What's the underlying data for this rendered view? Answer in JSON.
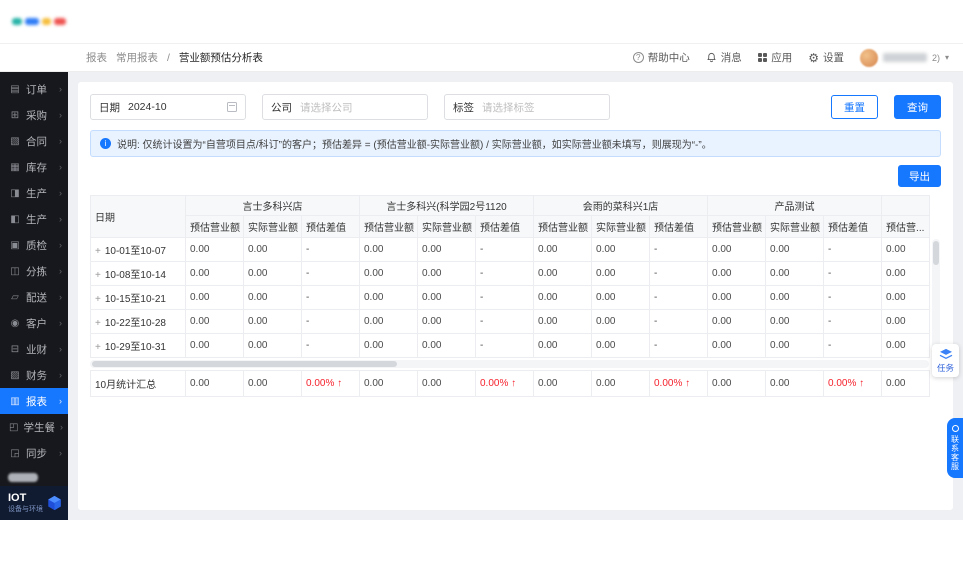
{
  "header": {
    "breadcrumb": {
      "root": "报表",
      "section": "常用报表",
      "current": "营业额预估分析表"
    },
    "help": "帮助中心",
    "messages": "消息",
    "apps": "应用",
    "settings": "设置",
    "user_suffix": "2)"
  },
  "sidebar": {
    "items": [
      {
        "name": "orders",
        "label": "订单",
        "icon": "orders-icon"
      },
      {
        "name": "purchase",
        "label": "采购",
        "icon": "purchase-icon"
      },
      {
        "name": "contract",
        "label": "合同",
        "icon": "contract-icon"
      },
      {
        "name": "inventory",
        "label": "库存",
        "icon": "inventory-icon"
      },
      {
        "name": "production-1",
        "label": "生产",
        "icon": "production-icon"
      },
      {
        "name": "production-2",
        "label": "生产",
        "icon": "production-icon"
      },
      {
        "name": "quality",
        "label": "质检",
        "icon": "quality-check-icon"
      },
      {
        "name": "sorting",
        "label": "分拣",
        "icon": "sorting-icon"
      },
      {
        "name": "delivery",
        "label": "配送",
        "icon": "delivery-icon"
      },
      {
        "name": "customer",
        "label": "客户",
        "icon": "customer-icon"
      },
      {
        "name": "biz-finance",
        "label": "业财",
        "icon": "biz-finance-icon"
      },
      {
        "name": "finance",
        "label": "财务",
        "icon": "finance-icon"
      },
      {
        "name": "reports",
        "label": "报表",
        "icon": "reports-icon",
        "active": true
      },
      {
        "name": "student-meal",
        "label": "学生餐",
        "icon": "student-meal-icon"
      },
      {
        "name": "sync",
        "label": "同步",
        "icon": "sync-icon"
      }
    ],
    "iot": {
      "title": "IOT",
      "subtitle": "设备与环境"
    }
  },
  "filters": {
    "date_label": "日期",
    "date_value": "2024-10",
    "company_label": "公司",
    "company_placeholder": "请选择公司",
    "tag_label": "标签",
    "tag_placeholder": "请选择标签",
    "reset": "重置",
    "query": "查询"
  },
  "notice": "说明: 仅统计设置为“自营项目点/科订”的客户；预估差异 = (预估营业额-实际营业额) / 实际营业额，如实际营业额未填写，则展现为“-”。",
  "export": "导出",
  "table": {
    "date_header": "日期",
    "groups": [
      "言士多科兴店",
      "言士多科兴(科学园2号1120",
      "会雨的菜科兴1店",
      "产品测试"
    ],
    "sub_headers": [
      "预估营业额",
      "实际营业额",
      "预估差值"
    ],
    "overflow_sub_header": "预估营...",
    "rows": [
      {
        "date": "10-01至10-07",
        "values": [
          "0.00",
          "0.00",
          "-",
          "0.00",
          "0.00",
          "-",
          "0.00",
          "0.00",
          "-",
          "0.00",
          "0.00",
          "-"
        ],
        "overflow": "0.00"
      },
      {
        "date": "10-08至10-14",
        "values": [
          "0.00",
          "0.00",
          "-",
          "0.00",
          "0.00",
          "-",
          "0.00",
          "0.00",
          "-",
          "0.00",
          "0.00",
          "-"
        ],
        "overflow": "0.00"
      },
      {
        "date": "10-15至10-21",
        "values": [
          "0.00",
          "0.00",
          "-",
          "0.00",
          "0.00",
          "-",
          "0.00",
          "0.00",
          "-",
          "0.00",
          "0.00",
          "-"
        ],
        "overflow": "0.00"
      },
      {
        "date": "10-22至10-28",
        "values": [
          "0.00",
          "0.00",
          "-",
          "0.00",
          "0.00",
          "-",
          "0.00",
          "0.00",
          "-",
          "0.00",
          "0.00",
          "-"
        ],
        "overflow": "0.00"
      },
      {
        "date": "10-29至10-31",
        "values": [
          "0.00",
          "0.00",
          "-",
          "0.00",
          "0.00",
          "-",
          "0.00",
          "0.00",
          "-",
          "0.00",
          "0.00",
          "-"
        ],
        "overflow": "0.00"
      }
    ],
    "summary": {
      "label": "10月统计汇总",
      "values": [
        "0.00",
        "0.00",
        "0.00%",
        "0.00",
        "0.00",
        "0.00%",
        "0.00",
        "0.00",
        "0.00%",
        "0.00",
        "0.00",
        "0.00%"
      ],
      "arrow": "↑",
      "overflow": "0.00"
    }
  },
  "floating": {
    "tasks": "任务",
    "service": "联系客服"
  }
}
